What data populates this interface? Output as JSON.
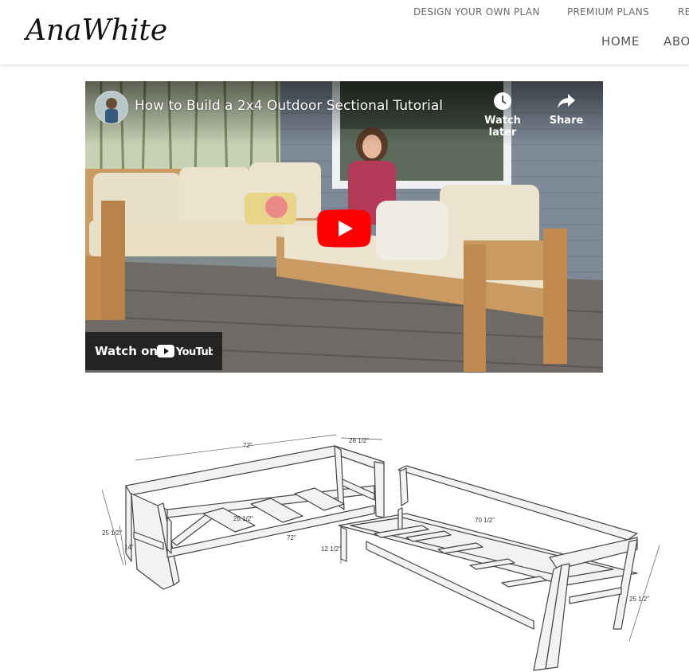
{
  "brand": {
    "logo_text": "AnaWhite"
  },
  "top_nav": {
    "items": [
      {
        "label": "DESIGN YOUR OWN PLAN"
      },
      {
        "label": "PREMIUM PLANS"
      },
      {
        "label": "RE"
      }
    ]
  },
  "main_nav": {
    "items": [
      {
        "label": "HOME"
      },
      {
        "label": "ABO"
      }
    ]
  },
  "video": {
    "title": "How to Build a 2x4 Outdoor Sectional Tutorial",
    "watch_later_label": "Watch later",
    "share_label": "Share",
    "watch_on_label": "Watch on",
    "platform_label": "YouTube",
    "play_icon": "play-icon",
    "accent_color": "#ff0000"
  },
  "diagram": {
    "dim_back_length": "72\"",
    "dim_side_depth": "28 1/2\"",
    "dim_seat_depth": "25 1/2\"",
    "dim_front_length": "72\"",
    "dim_height": "25 1/2\"",
    "dim_seat_height": "14\"",
    "dim_right_length": "70 1/2\"",
    "dim_right_seat_height": "12 1/2\"",
    "dim_right_height": "25 1/2\""
  }
}
